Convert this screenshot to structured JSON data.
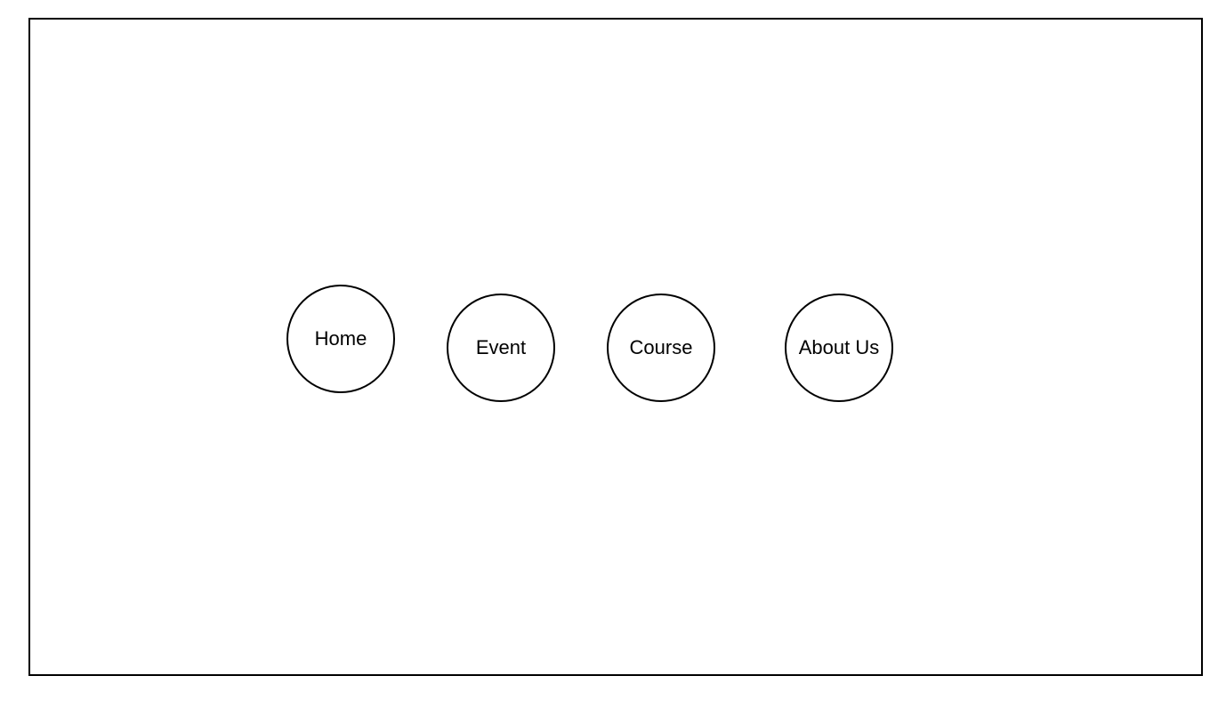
{
  "nav": {
    "items": [
      {
        "label": "Home"
      },
      {
        "label": "Event"
      },
      {
        "label": "Course"
      },
      {
        "label": "About Us"
      }
    ]
  }
}
